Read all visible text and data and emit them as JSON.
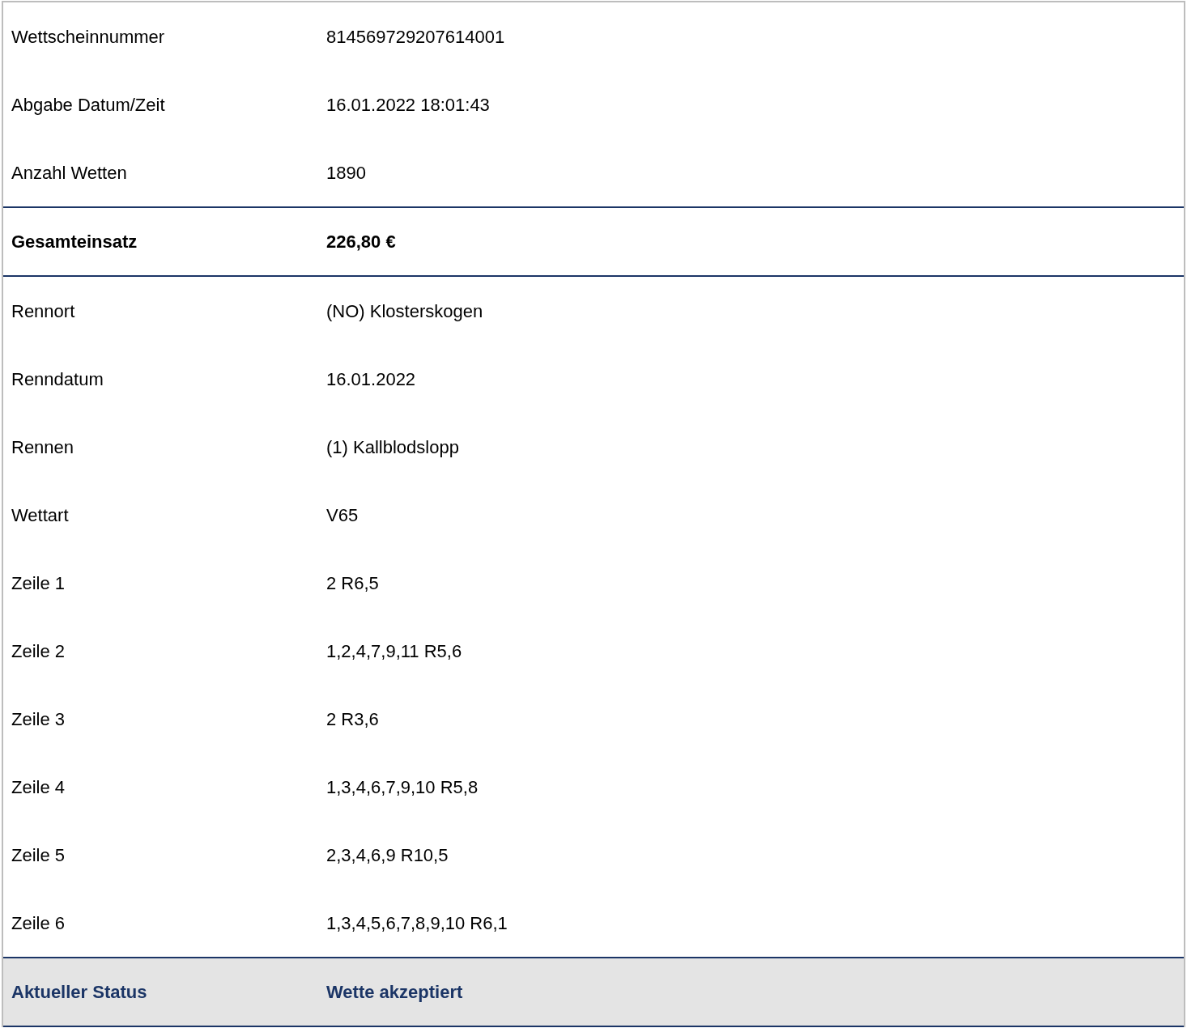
{
  "rows": [
    {
      "kind": "detail",
      "label": "Wettscheinnummer",
      "value": "814569729207614001"
    },
    {
      "kind": "detail",
      "label": "Abgabe Datum/Zeit",
      "value": "16.01.2022 18:01:43"
    },
    {
      "kind": "detail",
      "label": "Anzahl Wetten",
      "value": "1890"
    },
    {
      "kind": "total",
      "label": "Gesamteinsatz",
      "value": "226,80 €"
    },
    {
      "kind": "detail",
      "label": "Rennort",
      "value": "(NO) Klosterskogen"
    },
    {
      "kind": "detail",
      "label": "Renndatum",
      "value": "16.01.2022"
    },
    {
      "kind": "detail",
      "label": "Rennen",
      "value": "(1) Kallblodslopp"
    },
    {
      "kind": "detail",
      "label": "Wettart",
      "value": "V65"
    },
    {
      "kind": "detail",
      "label": "Zeile 1",
      "value": "2 R6,5"
    },
    {
      "kind": "detail",
      "label": "Zeile 2",
      "value": "1,2,4,7,9,11 R5,6"
    },
    {
      "kind": "detail",
      "label": "Zeile 3",
      "value": "2 R3,6"
    },
    {
      "kind": "detail",
      "label": "Zeile 4",
      "value": "1,3,4,6,7,9,10 R5,8"
    },
    {
      "kind": "detail",
      "label": "Zeile 5",
      "value": "2,3,4,6,9 R10,5"
    },
    {
      "kind": "detail",
      "label": "Zeile 6",
      "value": "1,3,4,5,6,7,8,9,10 R6,1"
    },
    {
      "kind": "status",
      "label": "Aktueller Status",
      "value": "Wette akzeptiert"
    }
  ]
}
